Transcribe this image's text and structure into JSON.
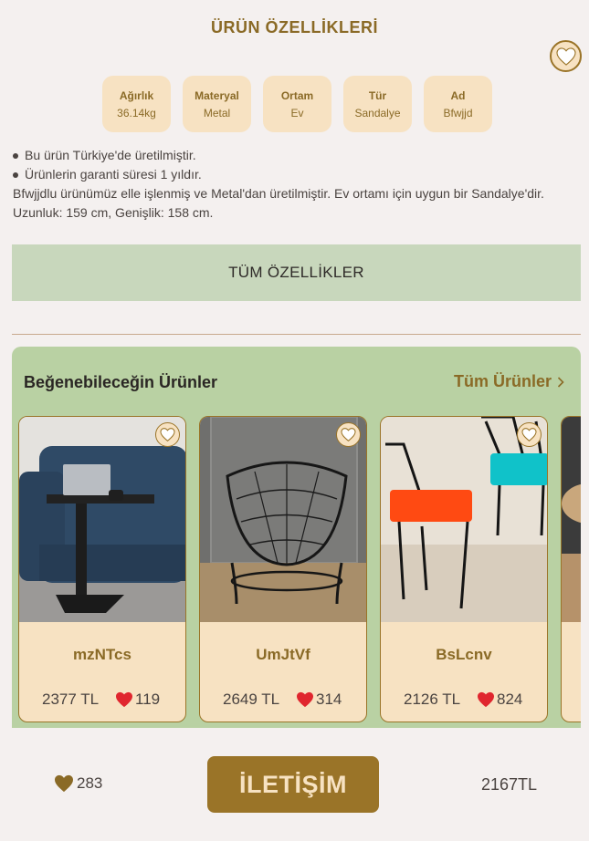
{
  "header": {
    "title": "ÜRÜN ÖZELLİKLERİ"
  },
  "features": [
    {
      "label": "Ağırlık",
      "value": "36.14kg"
    },
    {
      "label": "Materyal",
      "value": "Metal"
    },
    {
      "label": "Ortam",
      "value": "Ev"
    },
    {
      "label": "Tür",
      "value": "Sandalye"
    },
    {
      "label": "Ad",
      "value": "Bfwjjd"
    }
  ],
  "bullets": [
    "Bu ürün Türkiye'de üretilmiştir.",
    "Ürünlerin garanti süresi 1 yıldır."
  ],
  "description": "Bfwjjdlu ürünümüz elle işlenmiş ve Metal'dan üretilmiştir. Ev ortamı için uygun bir Sandalye'dir. Uzunluk: 159 cm, Genişlik: 158 cm.",
  "all_features_label": "TÜM ÖZELLİKLER",
  "recommendations": {
    "title": "Beğenebileceğin Ürünler",
    "all_label": "Tüm Ürünler",
    "products": [
      {
        "name": "mzNTcs",
        "price": "2377 TL",
        "likes": "119"
      },
      {
        "name": "UmJtVf",
        "price": "2649 TL",
        "likes": "314"
      },
      {
        "name": "BsLcnv",
        "price": "2126 TL",
        "likes": "824"
      }
    ]
  },
  "footer": {
    "likes": "283",
    "contact_label": "İLETİŞİM",
    "price": "2167TL"
  },
  "colors": {
    "accent": "#9a7428",
    "chip_bg": "#f7e2c2",
    "reco_bg": "#b9d1a3",
    "button_bg": "#c8d7bc",
    "heart": "#e0262e"
  }
}
